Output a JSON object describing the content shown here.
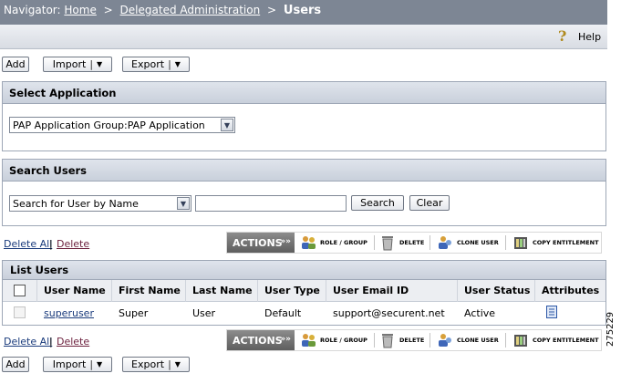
{
  "nav": {
    "label": "Navigator:",
    "crumbs": [
      "Home",
      "Delegated Administration"
    ],
    "separator": ">",
    "current": "Users"
  },
  "help": {
    "label": "Help"
  },
  "toolbar": {
    "add": "Add",
    "import": "Import",
    "export": "Export"
  },
  "select_application": {
    "title": "Select Application",
    "selected": "PAP Application Group:PAP Application"
  },
  "search_users": {
    "title": "Search Users",
    "mode": "Search for User by Name",
    "query": "",
    "search_button": "Search",
    "clear_button": "Clear"
  },
  "bulk_links": {
    "delete_all": "Delete All",
    "delete": "Delete"
  },
  "actions_bar": {
    "label": "ACTIONS",
    "role_group": "ROLE / GROUP",
    "delete": "DELETE",
    "clone_user": "CLONE USER",
    "copy_entitlement": "COPY ENTITLEMENT"
  },
  "list_users": {
    "title": "List Users",
    "columns": [
      "User Name",
      "First Name",
      "Last Name",
      "User Type",
      "User Email ID",
      "User Status",
      "Attributes"
    ],
    "rows": [
      {
        "user_name": "superuser",
        "first_name": "Super",
        "last_name": "User",
        "user_type": "Default",
        "email": "support@securent.net",
        "status": "Active"
      }
    ]
  },
  "figure_id": "275229",
  "colors": {
    "nav_bg": "#7d8694",
    "section_header": "#c9d0db",
    "link": "#1a3b7c"
  }
}
